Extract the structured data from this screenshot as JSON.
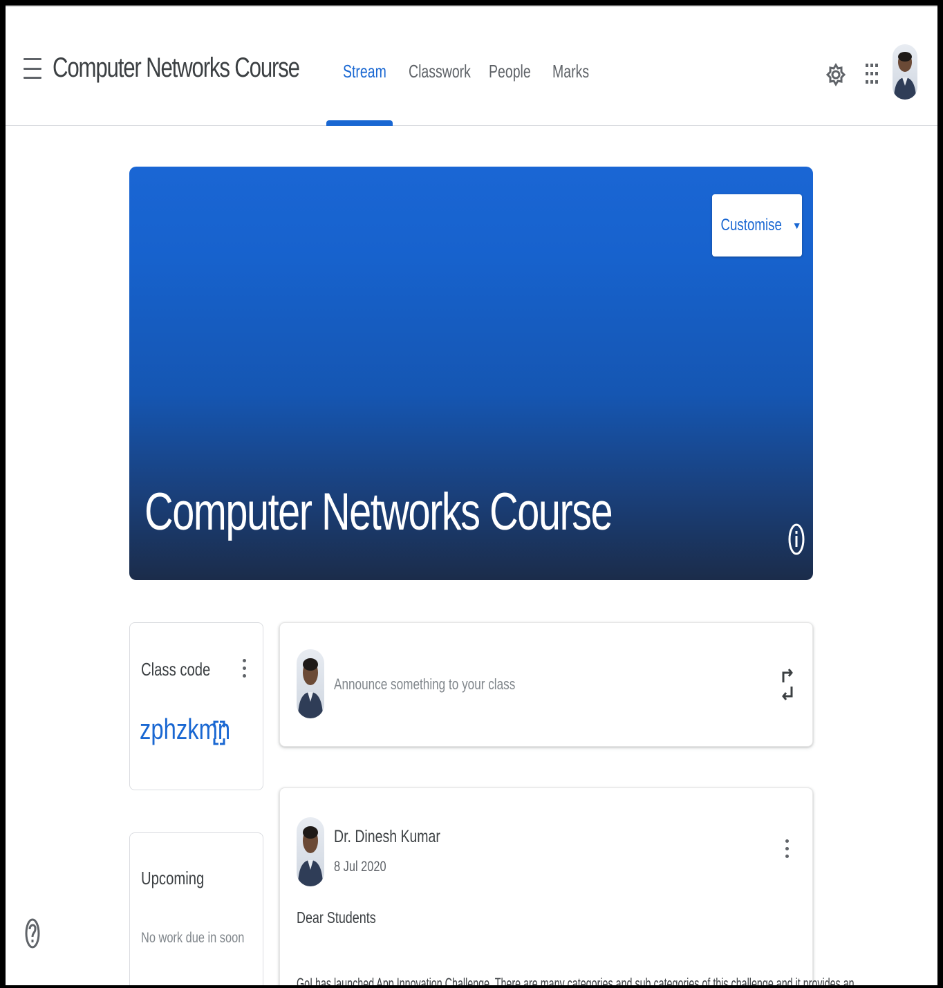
{
  "header": {
    "course_title": "Computer Networks Course",
    "tabs": [
      {
        "label": "Stream",
        "active": true
      },
      {
        "label": "Classwork",
        "active": false
      },
      {
        "label": "People",
        "active": false
      },
      {
        "label": "Marks",
        "active": false
      }
    ],
    "icons": [
      "menu-icon",
      "settings-icon",
      "apps-grid-icon",
      "account-avatar"
    ]
  },
  "banner": {
    "title": "Computer Networks Course",
    "customise_label": "Customise",
    "colors": {
      "top": "#1a66d4",
      "bottom": "#1b2c4a"
    }
  },
  "class_code": {
    "label": "Class code",
    "code": "zphzkmn"
  },
  "upcoming": {
    "label": "Upcoming",
    "empty_text": "No work due in soon"
  },
  "announce": {
    "placeholder": "Announce something to your class"
  },
  "post": {
    "author": "Dr. Dinesh Kumar",
    "date": "8 Jul 2020",
    "greeting": "Dear Students",
    "body": "GoI has launched App Innovation Challenge. There are many categories and sub categories of this challenge and it provides an"
  },
  "accent_color": "#1967d2"
}
